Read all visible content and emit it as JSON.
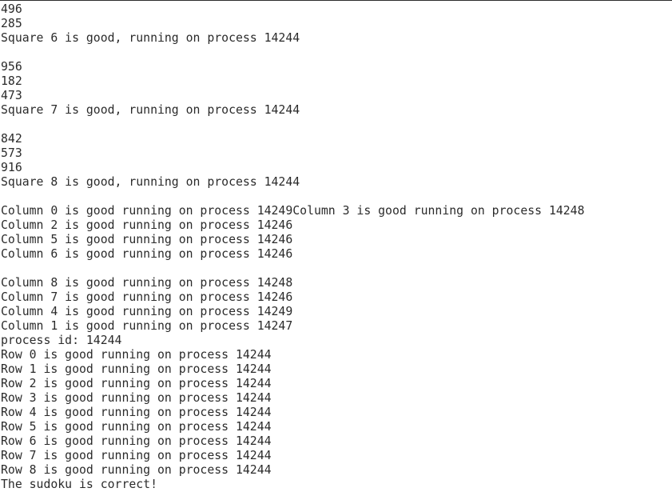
{
  "terminal": {
    "lines": [
      "496",
      "285",
      "Square 6 is good, running on process 14244",
      "",
      "956",
      "182",
      "473",
      "Square 7 is good, running on process 14244",
      "",
      "842",
      "573",
      "916",
      "Square 8 is good, running on process 14244",
      "",
      "Column 0 is good running on process 14249Column 3 is good running on process 14248",
      "Column 2 is good running on process 14246",
      "Column 5 is good running on process 14246",
      "Column 6 is good running on process 14246",
      "",
      "Column 8 is good running on process 14248",
      "Column 7 is good running on process 14246",
      "Column 4 is good running on process 14249",
      "Column 1 is good running on process 14247",
      "process id: 14244",
      "Row 0 is good running on process 14244",
      "Row 1 is good running on process 14244",
      "Row 2 is good running on process 14244",
      "Row 3 is good running on process 14244",
      "Row 4 is good running on process 14244",
      "Row 5 is good running on process 14244",
      "Row 6 is good running on process 14244",
      "Row 7 is good running on process 14244",
      "Row 8 is good running on process 14244",
      "The sudoku is correct!"
    ]
  }
}
